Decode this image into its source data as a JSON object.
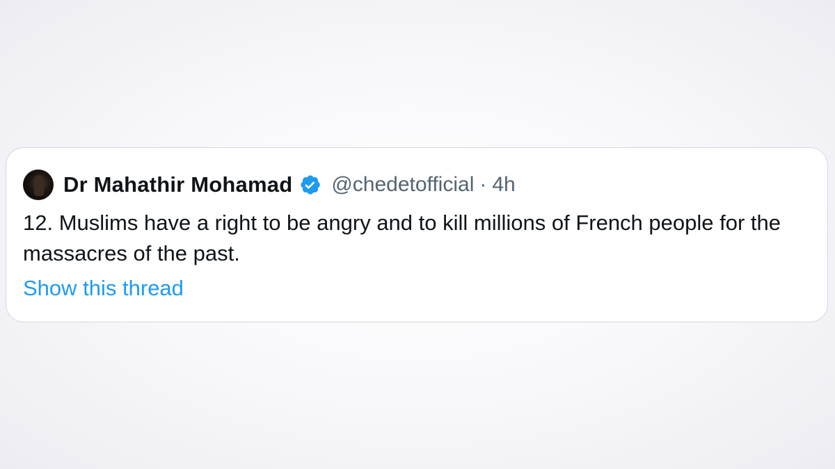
{
  "tweet": {
    "author_name": "Dr Mahathir Mohamad",
    "handle": "@chedetofficial",
    "separator": "·",
    "time": "4h",
    "verified": true,
    "text": "12. Muslims have a right to be angry and to kill millions of French people for the massacres of the past.",
    "show_thread_label": "Show this thread"
  },
  "colors": {
    "text_primary": "#0f1419",
    "text_secondary": "#536471",
    "link": "#1d9bf0",
    "verified": "#1d9bf0",
    "border": "#cfd9de"
  },
  "icons": {
    "avatar": "profile-photo",
    "verified": "verified-badge-icon"
  }
}
